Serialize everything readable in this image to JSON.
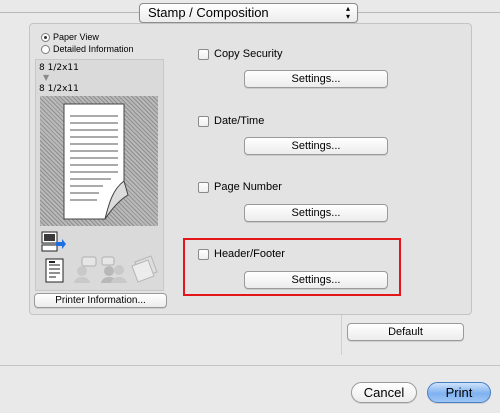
{
  "popup": {
    "value": "Stamp / Composition",
    "arrows": "▲▼"
  },
  "view_mode": {
    "options": [
      {
        "label": "Paper View",
        "checked": true
      },
      {
        "label": "Detailed Information",
        "checked": false
      }
    ]
  },
  "preview": {
    "size_top": "8 1/2x11",
    "size_bottom": "8 1/2x11",
    "arrow": "▼",
    "printer_info_label": "Printer Information..."
  },
  "options": [
    {
      "label": "Copy Security",
      "checked": false,
      "settings_label": "Settings..."
    },
    {
      "label": "Date/Time",
      "checked": false,
      "settings_label": "Settings..."
    },
    {
      "label": "Page Number",
      "checked": false,
      "settings_label": "Settings..."
    },
    {
      "label": "Header/Footer",
      "checked": false,
      "settings_label": "Settings..."
    }
  ],
  "buttons": {
    "default": "Default",
    "cancel": "Cancel",
    "print": "Print"
  },
  "colors": {
    "highlight": "#e2151b",
    "print_button": "#7fb2f0"
  }
}
